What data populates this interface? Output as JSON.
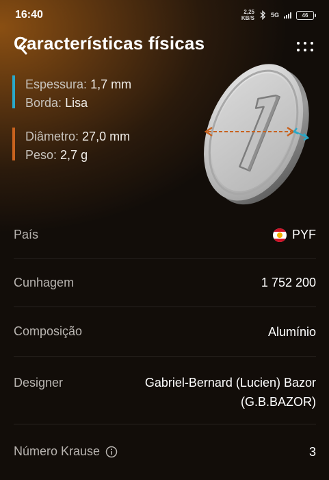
{
  "status_bar": {
    "time": "16:40",
    "net_speed_value": "2,25",
    "net_speed_unit": "KB/S",
    "network": "5G",
    "battery": "46"
  },
  "header": {
    "title": "Características físicas"
  },
  "specs": {
    "group1": [
      {
        "label": "Espessura:",
        "value": "1,7 mm"
      },
      {
        "label": "Borda:",
        "value": "Lisa"
      }
    ],
    "group2": [
      {
        "label": "Diâmetro:",
        "value": "27,0 mm"
      },
      {
        "label": "Peso:",
        "value": "2,7 g"
      }
    ],
    "colors": {
      "group1_bar": "#29a8c9",
      "group2_bar": "#c8621e",
      "diameter_arrow": "#c8621e",
      "thickness_arrow": "#29a8c9"
    }
  },
  "coin": {
    "face_value": "1"
  },
  "details": {
    "country_label": "País",
    "country_value": "PYF",
    "mintage_label": "Cunhagem",
    "mintage_value": "1 752 200",
    "composition_label": "Composição",
    "composition_value": "Alumínio",
    "designer_label": "Designer",
    "designer_value_line1": "Gabriel-Bernard (Lucien) Bazor",
    "designer_value_line2": "(G.B.BAZOR)",
    "krause_label": "Número Krause",
    "krause_value": "3"
  }
}
